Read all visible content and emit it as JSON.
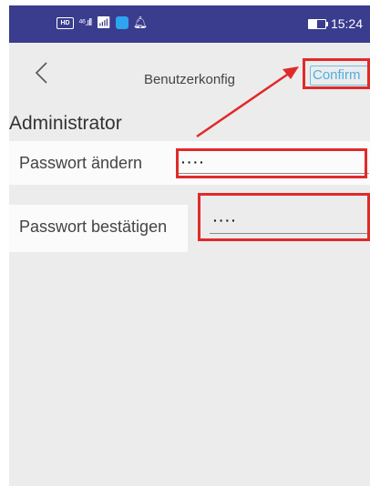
{
  "status_bar": {
    "hd_label": "HD",
    "signal_label": "⁴⁶.ıll",
    "time": "15:24",
    "battery_level": 0.5,
    "icons": [
      "hd-icon",
      "signal-icon",
      "wifi-icon",
      "app-notification-icon",
      "bell-icon",
      "battery-icon"
    ]
  },
  "nav": {
    "title": "Benutzerkonfig",
    "confirm_label": "Confirm"
  },
  "section": {
    "header": "Administrator"
  },
  "rows": [
    {
      "label": "Passwort ändern",
      "value": "····"
    },
    {
      "label": "Passwort bestätigen",
      "value": "····"
    }
  ],
  "colors": {
    "status_bar": "#3a3c8e",
    "annotation": "#e02a2a",
    "confirm": "#4ab0e6"
  }
}
